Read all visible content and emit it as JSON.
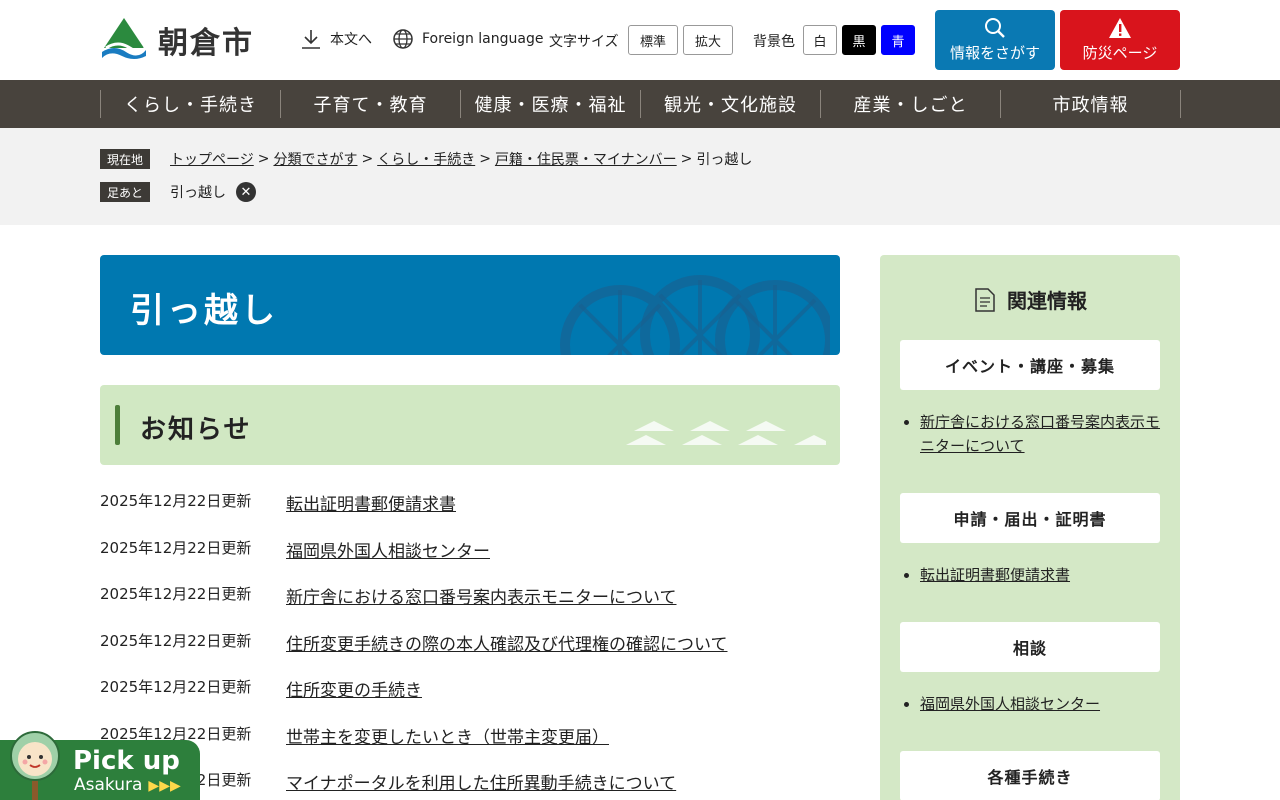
{
  "header": {
    "logo_text": "朝倉市",
    "skip_label": "本文へ",
    "foreign_label": "Foreign language",
    "font_size_label": "文字サイズ",
    "font_size_buttons": [
      "標準",
      "拡大"
    ],
    "bg_color_label": "背景色",
    "bg_buttons": [
      "白",
      "黒",
      "青"
    ],
    "search_button": "情報をさがす",
    "disaster_button": "防災ページ"
  },
  "gnav": [
    "くらし・手続き",
    "子育て・教育",
    "健康・医療・福祉",
    "観光・文化施設",
    "産業・しごと",
    "市政情報"
  ],
  "breadcrumb": {
    "current_tag": "現在地",
    "items": [
      "トップページ",
      "分類でさがす",
      "くらし・手続き",
      "戸籍・住民票・マイナンバー"
    ],
    "current": "引っ越し",
    "history_tag": "足あと",
    "history_item": "引っ越し",
    "separator": ">"
  },
  "main": {
    "title": "引っ越し",
    "section_title": "お知らせ",
    "news": [
      {
        "date": "2025年12月22日更新",
        "title": "転出証明書郵便請求書"
      },
      {
        "date": "2025年12月22日更新",
        "title": "福岡県外国人相談センター"
      },
      {
        "date": "2025年12月22日更新",
        "title": "新庁舎における窓口番号案内表示モニターについて"
      },
      {
        "date": "2025年12月22日更新",
        "title": "住所変更手続きの際の本人確認及び代理権の確認について"
      },
      {
        "date": "2025年12月22日更新",
        "title": "住所変更の手続き"
      },
      {
        "date": "2025年12月22日更新",
        "title": "世帯主を変更したいとき（世帯主変更届）"
      },
      {
        "date": "2025年12月22日更新",
        "title": "マイナポータルを利用した住所異動手続きについて"
      }
    ]
  },
  "sidebar": {
    "title": "関連情報",
    "categories": [
      {
        "label": "イベント・講座・募集",
        "links": [
          "新庁舎における窓口番号案内表示モニターについて"
        ]
      },
      {
        "label": "申請・届出・証明書",
        "links": [
          "転出証明書郵便請求書"
        ]
      },
      {
        "label": "相談",
        "links": [
          "福岡県外国人相談センター"
        ]
      },
      {
        "label": "各種手続き",
        "links": []
      }
    ]
  },
  "pickup": {
    "title": "Pick up",
    "subtitle": "Asakura",
    "arrows": "▶▶▶"
  },
  "colors": {
    "nav_bg": "#48433d",
    "search_btn": "#0a79b3",
    "disaster_btn": "#d9141c",
    "title_bg": "#0078b0",
    "section_bg": "#d1e8c3",
    "pickup_bg": "#2d7f3c"
  }
}
